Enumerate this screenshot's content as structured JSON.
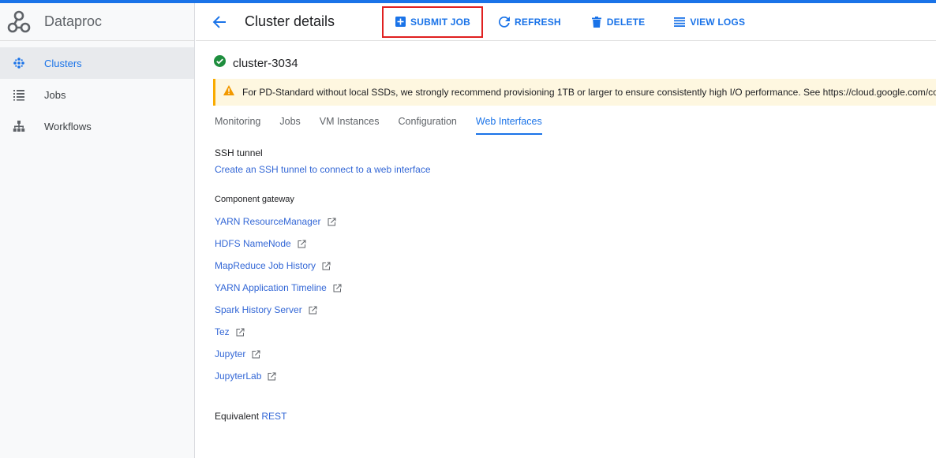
{
  "app": {
    "product_name": "Dataproc"
  },
  "sidebar": {
    "items": [
      {
        "label": "Clusters",
        "icon": "clusters-icon",
        "active": true
      },
      {
        "label": "Jobs",
        "icon": "list-icon",
        "active": false
      },
      {
        "label": "Workflows",
        "icon": "workflow-icon",
        "active": false
      }
    ]
  },
  "header": {
    "title": "Cluster details",
    "actions": {
      "submit_job": "SUBMIT JOB",
      "refresh": "REFRESH",
      "delete": "DELETE",
      "view_logs": "VIEW LOGS"
    }
  },
  "cluster": {
    "name": "cluster-3034",
    "status": "running"
  },
  "warning": {
    "text": "For PD-Standard without local SSDs, we strongly recommend provisioning 1TB or larger to ensure consistently high I/O performance. See https://cloud.google.com/compute/docs/disks/performance"
  },
  "tabs": [
    {
      "label": "Monitoring"
    },
    {
      "label": "Jobs"
    },
    {
      "label": "VM Instances"
    },
    {
      "label": "Configuration"
    },
    {
      "label": "Web Interfaces",
      "active": true
    }
  ],
  "ssh_tunnel": {
    "title": "SSH tunnel",
    "link": "Create an SSH tunnel to connect to a web interface"
  },
  "component_gateway": {
    "title": "Component gateway",
    "links": [
      "YARN ResourceManager",
      "HDFS NameNode",
      "MapReduce Job History",
      "YARN Application Timeline",
      "Spark History Server",
      "Tez",
      "Jupyter",
      "JupyterLab"
    ]
  },
  "equivalent": {
    "prefix": "Equivalent",
    "link": "REST"
  },
  "colors": {
    "accent": "#1a73e8",
    "highlight_box": "#e02020",
    "warning": "#f9ab00",
    "success": "#1e8e3e"
  }
}
